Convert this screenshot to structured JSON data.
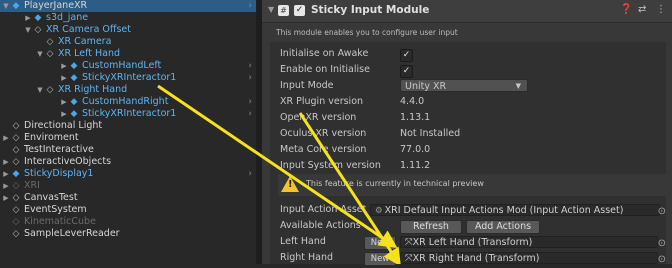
{
  "hierarchy": {
    "items": [
      {
        "label": "PlayerJaneXR",
        "icon": "cube-icon",
        "style": "white"
      },
      {
        "label": "s3d_jane",
        "icon": "cube-icon",
        "style": "blue"
      },
      {
        "label": "XR Camera Offset",
        "icon": "gameobject-icon",
        "style": "blue"
      },
      {
        "label": "XR Camera",
        "icon": "gameobject-icon",
        "style": "blue"
      },
      {
        "label": "XR Left Hand",
        "icon": "gameobject-icon",
        "style": "blue"
      },
      {
        "label": "CustomHandLeft",
        "icon": "cube-icon",
        "style": "blue"
      },
      {
        "label": "StickyXRInteractor1",
        "icon": "cube-icon",
        "style": "blue"
      },
      {
        "label": "XR Right Hand",
        "icon": "gameobject-icon",
        "style": "blue"
      },
      {
        "label": "CustomHandRight",
        "icon": "cube-icon",
        "style": "blue"
      },
      {
        "label": "StickyXRInteractor1",
        "icon": "cube-icon",
        "style": "blue"
      },
      {
        "label": "Directional Light",
        "icon": "gameobject-icon",
        "style": "white"
      },
      {
        "label": "Enviroment",
        "icon": "gameobject-icon",
        "style": "white"
      },
      {
        "label": "TestInteractive",
        "icon": "gameobject-icon",
        "style": "white"
      },
      {
        "label": "InteractiveObjects",
        "icon": "gameobject-icon",
        "style": "white"
      },
      {
        "label": "StickyDisplay1",
        "icon": "cube-icon",
        "style": "blue"
      },
      {
        "label": "XRI",
        "icon": "gameobject-icon",
        "style": "dim"
      },
      {
        "label": "CanvasTest",
        "icon": "gameobject-icon",
        "style": "white"
      },
      {
        "label": "EventSystem",
        "icon": "gameobject-icon",
        "style": "white"
      },
      {
        "label": "KinematicCube",
        "icon": "gameobject-icon",
        "style": "dim"
      },
      {
        "label": "SampleLeverReader",
        "icon": "gameobject-icon",
        "style": "white"
      }
    ]
  },
  "inspector": {
    "component_title": "Sticky Input Module",
    "enabled": true,
    "description": "This module enables you to configure user input",
    "properties": [
      {
        "label": "Initialise on Awake",
        "type": "toggle",
        "value": true
      },
      {
        "label": "Enable on Initialise",
        "type": "toggle",
        "value": true
      },
      {
        "label": "Input Mode",
        "type": "dropdown",
        "value": "Unity XR"
      },
      {
        "label": "XR Plugin version",
        "type": "text",
        "value": "4.4.0"
      },
      {
        "label": "OpenXR version",
        "type": "text",
        "value": "1.13.1"
      },
      {
        "label": "Oculus XR version",
        "type": "text",
        "value": "Not Installed"
      },
      {
        "label": "Meta Core version",
        "type": "text",
        "value": "77.0.0"
      },
      {
        "label": "Input System version",
        "type": "text",
        "value": "1.11.2"
      }
    ],
    "warning": "This feature is currently in technical preview",
    "input_action_asset": {
      "label": "Input Action Asset",
      "value": "XRI Default Input Actions Mod (Input Action Asset)"
    },
    "available_actions": {
      "label": "Available Actions",
      "refresh": "Refresh",
      "add": "Add Actions"
    },
    "left_hand": {
      "label": "Left Hand",
      "new": "New",
      "value": "XR Left Hand (Transform)"
    },
    "right_hand": {
      "label": "Right Hand",
      "new": "New",
      "value": "XR Right Hand (Transform)"
    }
  },
  "colors": {
    "selection": "#2c5d87",
    "prefab_blue": "#5fb4f0",
    "annotation_arrow": "#f5e21c",
    "warning": "#f2c230"
  }
}
